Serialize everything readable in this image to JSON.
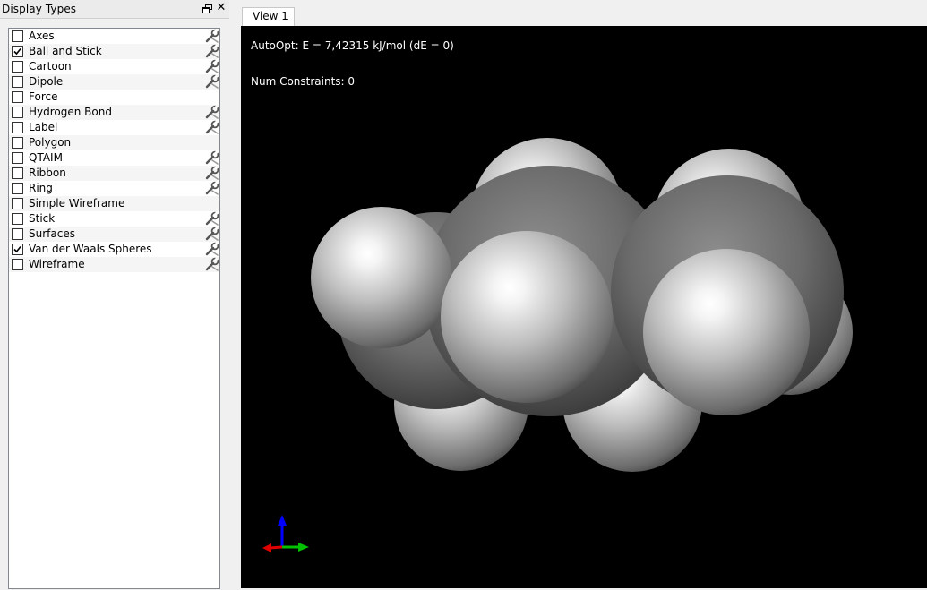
{
  "dock": {
    "title": "Display Types",
    "float_icon": "float-icon",
    "close_label": "✕"
  },
  "display_types": [
    {
      "label": "Axes",
      "checked": false,
      "has_settings": true
    },
    {
      "label": "Ball and Stick",
      "checked": true,
      "has_settings": true
    },
    {
      "label": "Cartoon",
      "checked": false,
      "has_settings": true
    },
    {
      "label": "Dipole",
      "checked": false,
      "has_settings": true
    },
    {
      "label": "Force",
      "checked": false,
      "has_settings": false
    },
    {
      "label": "Hydrogen Bond",
      "checked": false,
      "has_settings": true
    },
    {
      "label": "Label",
      "checked": false,
      "has_settings": true
    },
    {
      "label": "Polygon",
      "checked": false,
      "has_settings": false
    },
    {
      "label": "QTAIM",
      "checked": false,
      "has_settings": true
    },
    {
      "label": "Ribbon",
      "checked": false,
      "has_settings": true
    },
    {
      "label": "Ring",
      "checked": false,
      "has_settings": true
    },
    {
      "label": "Simple Wireframe",
      "checked": false,
      "has_settings": false
    },
    {
      "label": "Stick",
      "checked": false,
      "has_settings": true
    },
    {
      "label": "Surfaces",
      "checked": false,
      "has_settings": true
    },
    {
      "label": "Van der Waals Spheres",
      "checked": true,
      "has_settings": true
    },
    {
      "label": "Wireframe",
      "checked": false,
      "has_settings": true
    }
  ],
  "view": {
    "tab_label": "View 1",
    "energy_text": "AutoOpt: E = 7,42315 kJ/mol (dE = 0)",
    "constraints_text": "Num Constraints: 0",
    "background": "#000000"
  },
  "colors": {
    "carbon": "#6e6e6e",
    "hydrogen": "#dcdcdc",
    "axis_x": "#e00000",
    "axis_y": "#00c000",
    "axis_z": "#0000ff"
  }
}
